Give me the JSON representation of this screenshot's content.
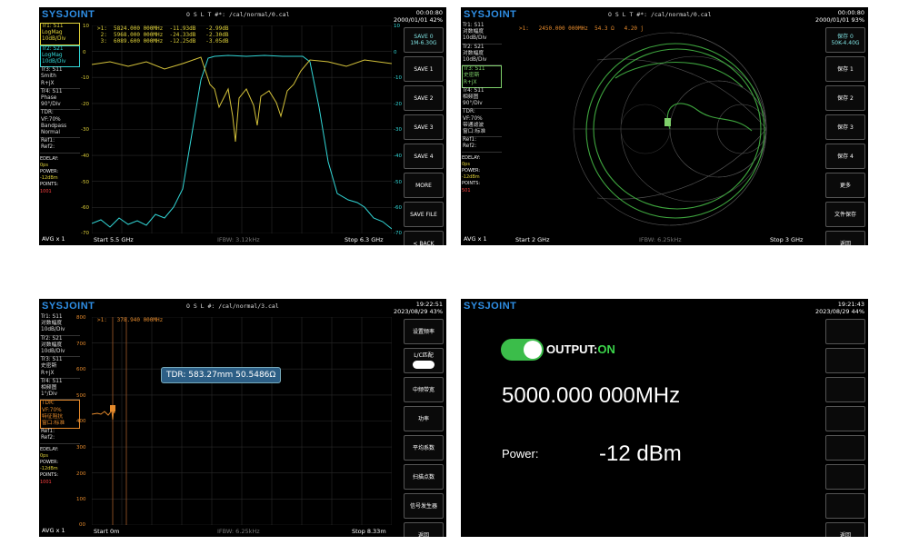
{
  "brand": "SYSJOINT",
  "panels": [
    {
      "cal_file": "O S L T #*:     /cal/normal/0.cal",
      "time": "00:00:80",
      "date": "2000/01/01",
      "battery": "42%",
      "traces": [
        "Tr1:   S11",
        "LogMag",
        "10dB/Div",
        "Tr2:   S21",
        "LogMag",
        "10dB/Div",
        "Tr3:   S11",
        "Smith",
        "R+jX",
        "Tr4:   S11",
        "Phase",
        "90°/Div",
        "TDR:",
        "VF:70%",
        "Bandpass",
        "Normal",
        "Ref1:",
        "Ref2:"
      ],
      "edelay_label": "EDELAY:",
      "edelay": "0ps",
      "power_label": "POWER:",
      "power": "-12dBm",
      "points_label": "POINTS:",
      "points": "1001",
      "avg": "AVG x 1",
      "start": "Start   5.5 GHz",
      "rbw": "IFBW: 3.12kHz",
      "stop": "Stop   6.3 GHz",
      "markers": ">1:  5824.000 000MHz  -11.93dB   -2.99dB\n 2:  5968.000 000MHz  -24.33dB   -2.30dB\n 3:  6089.600 000MHz  -12.25dB   -3.05dB",
      "yticks_left": [
        "10",
        "0",
        "-10",
        "-20",
        "-30",
        "-40",
        "-50",
        "-60",
        "-70"
      ],
      "yticks_right": [
        "10",
        "0",
        "-10",
        "-20",
        "-30",
        "-40",
        "-50",
        "-60",
        "-70"
      ],
      "menu": [
        "SAVE 0\n1M-6.30G",
        "SAVE 1",
        "SAVE 2",
        "SAVE 3",
        "SAVE 4",
        "MORE",
        "SAVE FILE",
        "< BACK"
      ]
    },
    {
      "cal_file": "O S L T #*:     /cal/normal/0.cal",
      "time": "00:00:80",
      "date": "2000/01/01",
      "battery": "93%",
      "traces": [
        "Tr1:   S11",
        "对数幅度",
        "10dB/Div",
        "Tr2:   S21",
        "对数幅度",
        "10dB/Div",
        "Tr3:   S11",
        "史密斯",
        "R+jX",
        "Tr4:   S11",
        "相频图",
        "90°/Div",
        "TDR:",
        "VF:70%",
        "带通滤波",
        "窗口:标准",
        "Ref1:",
        "Ref2:"
      ],
      "edelay_label": "EDELAY:",
      "edelay": "0ps",
      "power_label": "POWER:",
      "power": "-12dBm",
      "points_label": "POINTS:",
      "points": "501",
      "avg": "AVG x 1",
      "start": "Start   2 GHz",
      "rbw": "IFBW: 6.25kHz",
      "stop": "Stop   3 GHz",
      "markers": ">1:   2450.000 000MHz  54.3 Ω   4.20 j",
      "menu": [
        "保存 0\n50K-4.40G",
        "保存 1",
        "保存 2",
        "保存 3",
        "保存 4",
        "更多",
        "文件保存",
        "返回"
      ]
    },
    {
      "cal_file": "O S L #:           /cal/normal/3.cal",
      "time": "19:22:51",
      "date": "2023/08/29",
      "battery": "43%",
      "traces": [
        "Tr1:   S11",
        "对数幅度",
        "10dB/Div",
        "Tr2:   S21",
        "对数幅度",
        "10dB/Div",
        "Tr3:   S11",
        "史密斯",
        "R+jX",
        "Tr4:   S11",
        "相频图",
        "1°/Div",
        "TDR:",
        "VF:70%",
        "特征阻抗",
        "窗口:标准",
        "Ref1:",
        "Ref2:"
      ],
      "edelay_label": "EDELAY:",
      "edelay": "0ps",
      "power_label": "POWER:",
      "power": "-12dBm",
      "points_label": "POINTS:",
      "points": "1001",
      "avg": "AVG x 1",
      "start": "Start 0m",
      "rbw": "IFBW: 6.25kHz",
      "stop": "Stop 8.33m",
      "markers": ">1:   378.940 000MHz",
      "yticks_left": [
        "800",
        "700",
        "600",
        "500",
        "400",
        "300",
        "200",
        "100",
        "00"
      ],
      "tdr_readout": "TDR: 583.27mm 50.5486Ω",
      "menu": [
        "设置频率",
        "L/C匹配",
        "中频带宽",
        "功率",
        "平均系数",
        "扫描点数",
        "信号发生器",
        "返回"
      ]
    },
    {
      "time": "19:21:43",
      "date": "2023/08/29",
      "battery": "44%",
      "output_label": "OUTPUT:",
      "output_state": "ON",
      "frequency": "5000.000 000MHz",
      "power_label": "Power:",
      "power_value": "-12 dBm",
      "menu": [
        "",
        "",
        "",
        "",
        "",
        "",
        "",
        "返回"
      ]
    }
  ]
}
